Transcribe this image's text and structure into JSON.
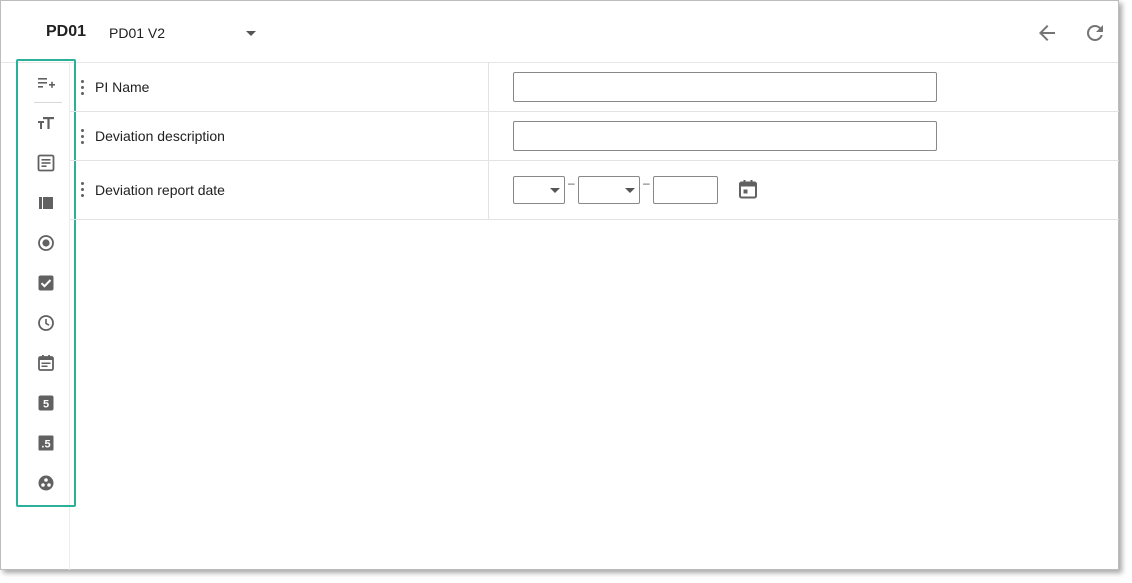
{
  "header": {
    "form_code": "PD01",
    "version": "PD01 V2"
  },
  "toolbar": {
    "icons": [
      "add-field-icon",
      "text-size-icon",
      "text-area-icon",
      "section-icon",
      "radio-icon",
      "checkbox-icon",
      "clock-icon",
      "calendar-icon",
      "number-icon",
      "decimal-icon",
      "lookup-icon"
    ],
    "number_glyph": "5",
    "decimal_glyph": ".5"
  },
  "fields": [
    {
      "label": "PI Name",
      "value": "",
      "type": "text"
    },
    {
      "label": "Deviation description",
      "value": "",
      "type": "text"
    },
    {
      "label": "Deviation report date",
      "type": "date",
      "day": "",
      "month": "",
      "year": ""
    }
  ],
  "date_separator": "–",
  "colors": {
    "accent": "#2bb19a",
    "icon": "#616161"
  }
}
